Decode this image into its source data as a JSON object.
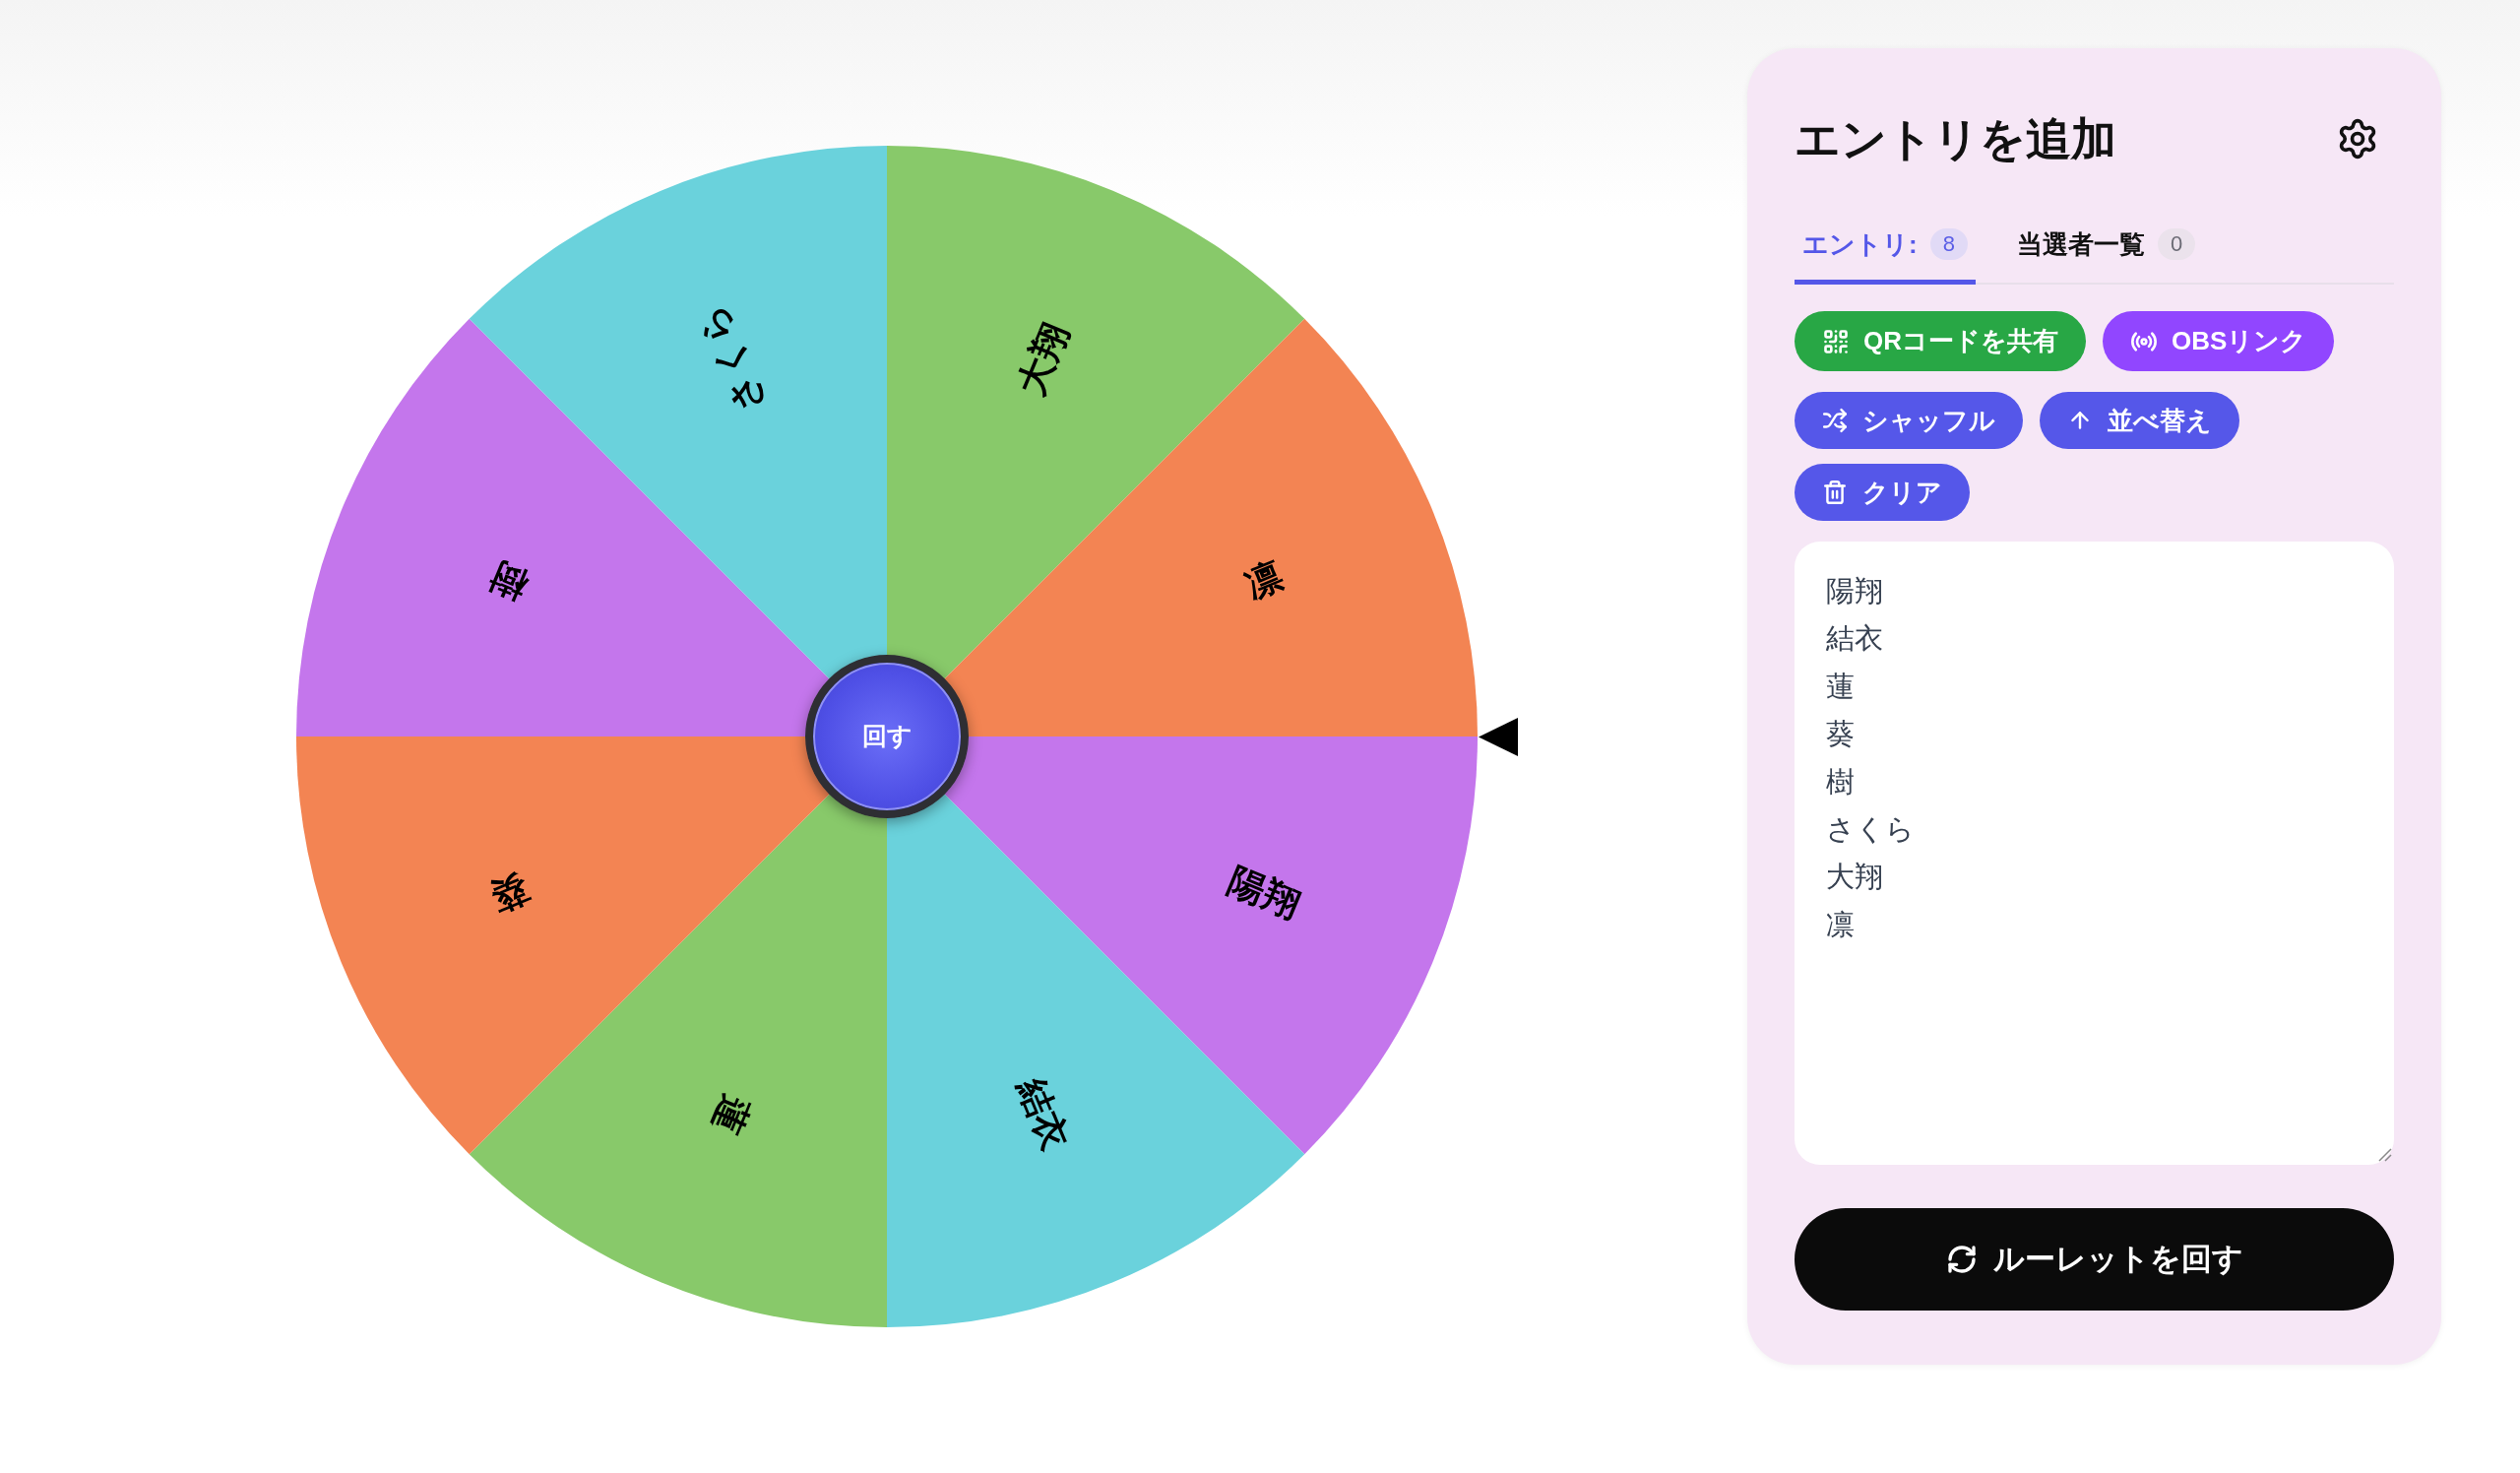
{
  "wheel": {
    "segments": [
      {
        "label": "陽翔",
        "color": "#c476ec"
      },
      {
        "label": "結衣",
        "color": "#6ad2dc"
      },
      {
        "label": "蓮",
        "color": "#88c96a"
      },
      {
        "label": "葵",
        "color": "#f38453"
      },
      {
        "label": "樹",
        "color": "#c476ec"
      },
      {
        "label": "さくら",
        "color": "#6ad2dc"
      },
      {
        "label": "大翔",
        "color": "#88c96a"
      },
      {
        "label": "凛",
        "color": "#f38453"
      }
    ],
    "spin_button": "回す"
  },
  "panel": {
    "title": "エントリを追加",
    "tabs": [
      {
        "label": "エントリ:",
        "count": "8",
        "selected": true
      },
      {
        "label": "当選者一覧",
        "count": "0",
        "selected": false
      }
    ],
    "share_buttons": [
      {
        "kind": "qr",
        "label": "QRコードを共有",
        "color": "#28a745"
      },
      {
        "kind": "broadcast",
        "label": "OBSリンク",
        "color": "#9146ff"
      }
    ],
    "tool_buttons": [
      {
        "kind": "shuffle",
        "label": "シャッフル"
      },
      {
        "kind": "sort",
        "label": "並べ替え"
      },
      {
        "kind": "clear",
        "label": "クリア"
      }
    ],
    "entries": [
      "陽翔",
      "結衣",
      "蓮",
      "葵",
      "樹",
      "さくら",
      "大翔",
      "凛"
    ],
    "spin_button": "ルーレットを回す"
  }
}
